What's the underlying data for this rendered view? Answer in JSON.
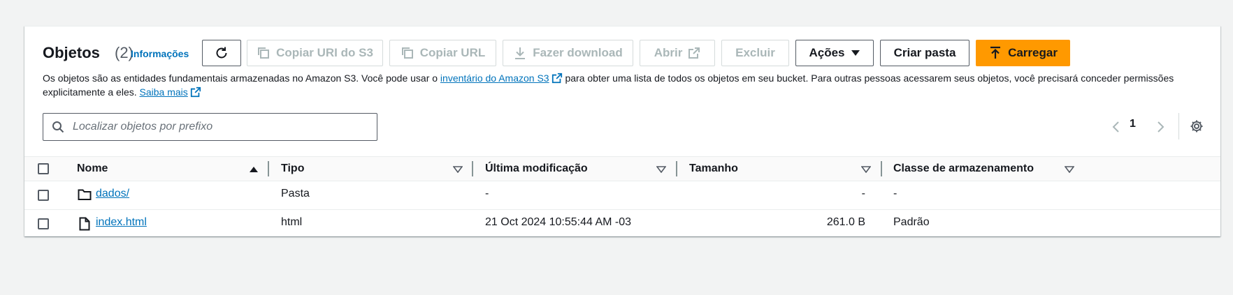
{
  "header": {
    "title": "Objetos",
    "count": "(2)",
    "info_link": "Informações"
  },
  "toolbar": {
    "refresh_icon": "refresh-icon",
    "copy_uri_label": "Copiar URI do S3",
    "copy_url_label": "Copiar URL",
    "download_label": "Fazer download",
    "open_label": "Abrir",
    "delete_label": "Excluir",
    "actions_label": "Ações",
    "create_folder_label": "Criar pasta",
    "upload_label": "Carregar"
  },
  "description": {
    "part1": "Os objetos são as entidades fundamentais armazenadas no Amazon S3. Você pode usar o ",
    "inventory_link": "inventário do Amazon S3",
    "part2": " para obter uma lista de todos os objetos em seu bucket. Para outras pessoas acessarem seus objetos, você precisará conceder permissões explicitamente a eles. ",
    "learn_more_link": "Saiba mais"
  },
  "search": {
    "placeholder": "Localizar objetos por prefixo",
    "value": ""
  },
  "pagination": {
    "current_page": "1"
  },
  "table": {
    "columns": {
      "name": "Nome",
      "type": "Tipo",
      "modified": "Última modificação",
      "size": "Tamanho",
      "storage_class": "Classe de armazenamento"
    },
    "rows": [
      {
        "icon": "folder-icon",
        "name": "dados/",
        "type": "Pasta",
        "modified": "-",
        "size": "-",
        "storage_class": "-"
      },
      {
        "icon": "file-icon",
        "name": "index.html",
        "type": "html",
        "modified": "21 Oct 2024 10:55:44 AM -03",
        "size": "261.0 B",
        "storage_class": "Padrão"
      }
    ]
  },
  "colors": {
    "accent": "#ff9900",
    "link": "#0073bb",
    "disabled": "#aab7b8",
    "background": "#f2f3f3"
  }
}
